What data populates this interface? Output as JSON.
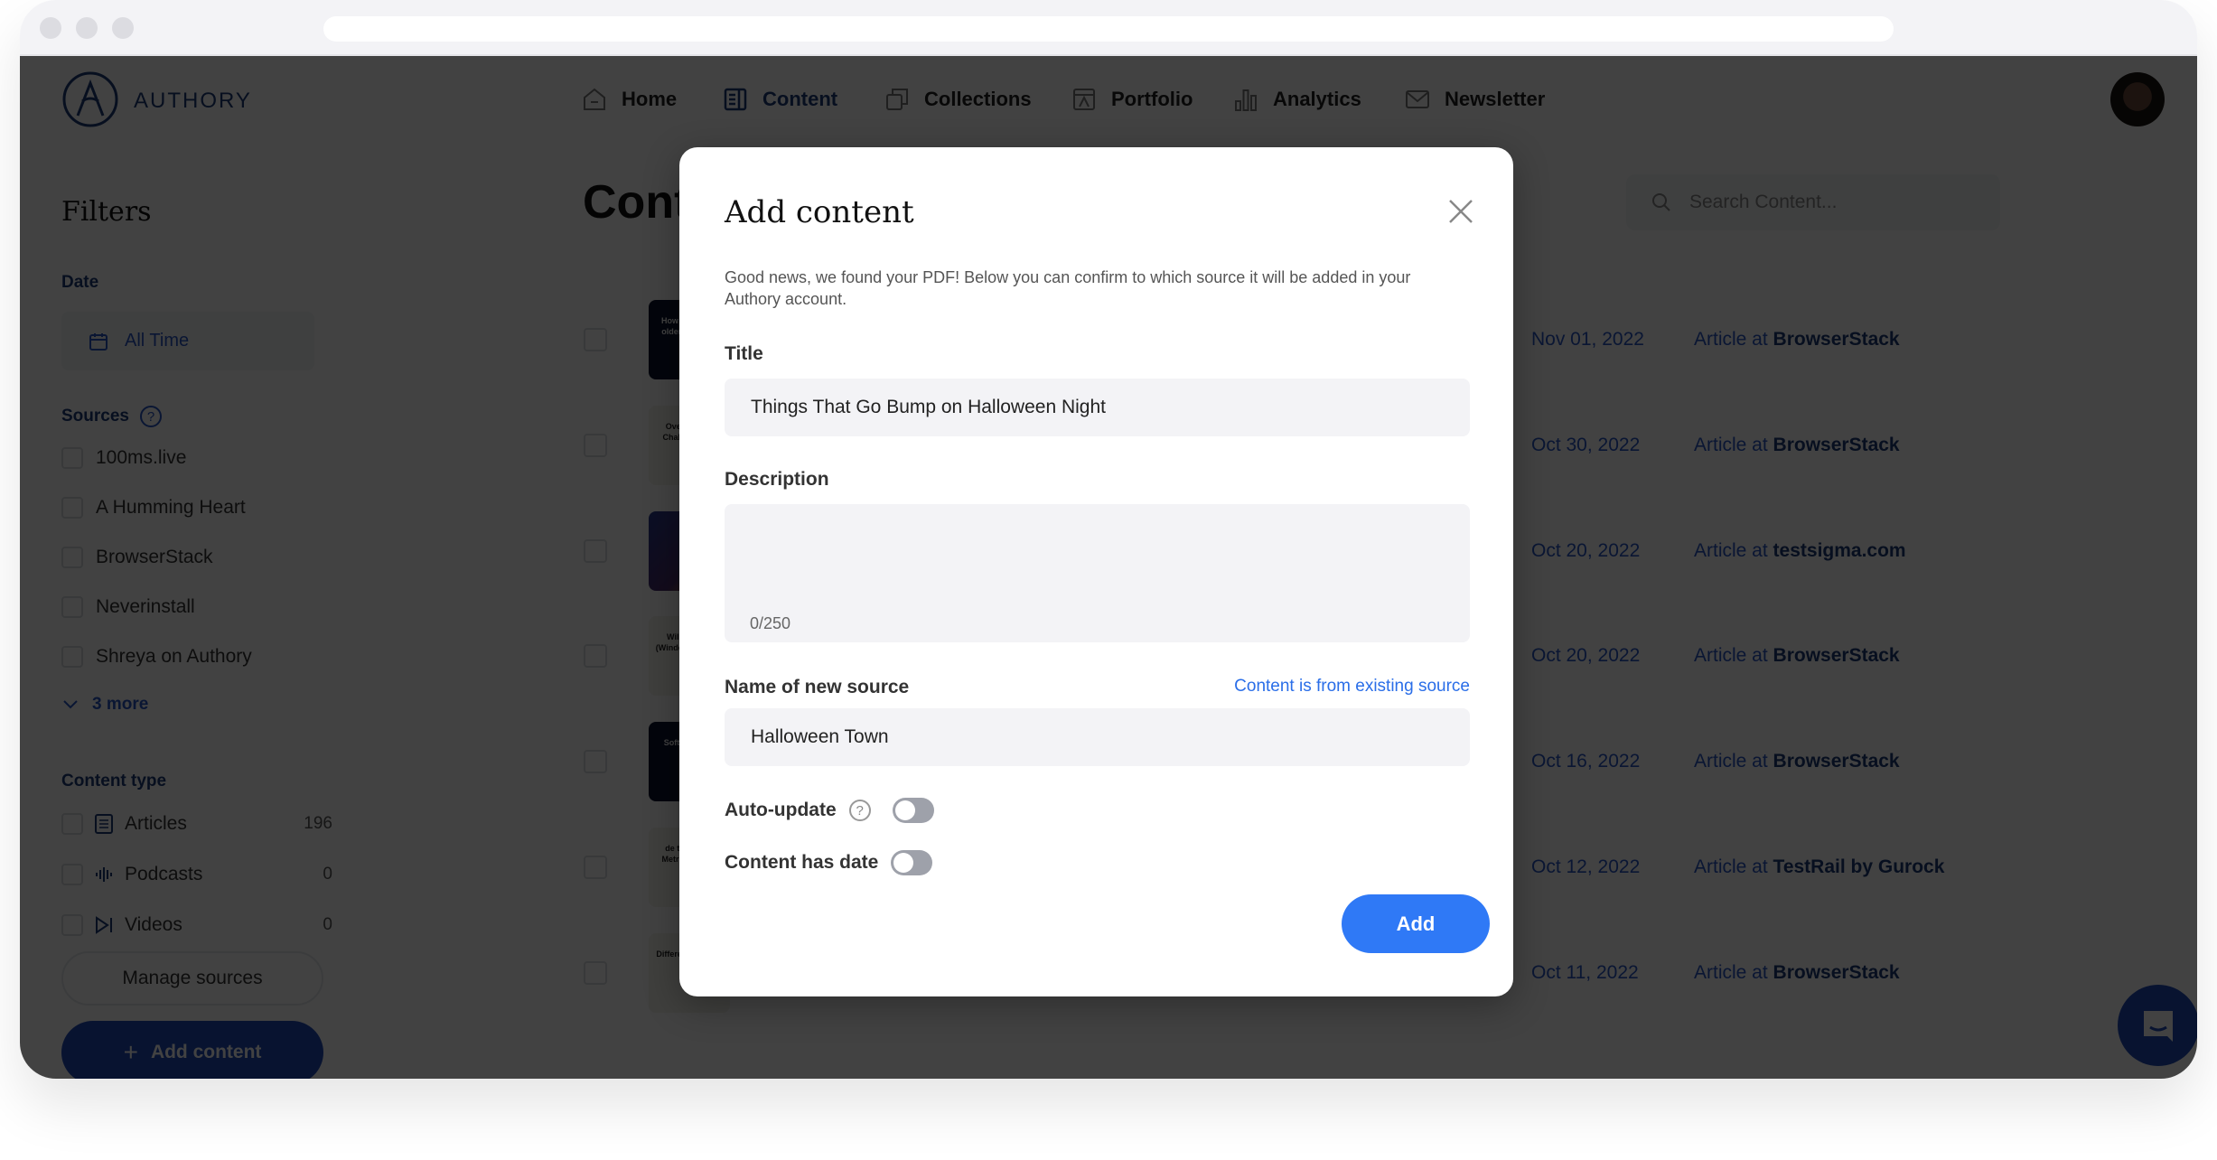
{
  "browser": {
    "traffic_lights": [
      "close",
      "minimize",
      "maximize"
    ],
    "url": ""
  },
  "header": {
    "brand": "AUTHORY",
    "nav": [
      {
        "label": "Home",
        "icon": "home-icon",
        "active": false
      },
      {
        "label": "Content",
        "icon": "content-icon",
        "active": true
      },
      {
        "label": "Collections",
        "icon": "collections-icon",
        "active": false
      },
      {
        "label": "Portfolio",
        "icon": "portfolio-icon",
        "active": false
      },
      {
        "label": "Analytics",
        "icon": "analytics-icon",
        "active": false
      },
      {
        "label": "Newsletter",
        "icon": "newsletter-icon",
        "active": false
      }
    ]
  },
  "sidebar": {
    "title": "Filters",
    "date_label": "Date",
    "date_value": "All Time",
    "sources_label": "Sources",
    "sources": [
      "100ms.live",
      "A Humming Heart",
      "BrowserStack",
      "Neverinstall",
      "Shreya on Authory"
    ],
    "more_label": "3 more",
    "content_type_label": "Content type",
    "content_types": [
      {
        "label": "Articles",
        "count": "196"
      },
      {
        "label": "Podcasts",
        "count": "0"
      },
      {
        "label": "Videos",
        "count": "0"
      }
    ],
    "manage_sources_label": "Manage sources",
    "add_content_label": "Add content"
  },
  "main": {
    "title": "Content",
    "search_placeholder": "Search Content...",
    "rows": [
      {
        "thumb_text": "How to test on older versions",
        "date": "Nov 01, 2022",
        "prefix": "Article at",
        "source": "BrowserStack"
      },
      {
        "thumb_text": "Overcoming Challenges of Test",
        "date": "Oct 30, 2022",
        "prefix": "Article at",
        "source": "BrowserStack"
      },
      {
        "thumb_text": "",
        "date": "Oct 20, 2022",
        "prefix": "Article at",
        "source": "testsigma.com"
      },
      {
        "thumb_text": "Will the iOS (Windows testing",
        "date": "Oct 20, 2022",
        "prefix": "Article at",
        "source": "BrowserStack"
      },
      {
        "thumb_text": "Software and",
        "date": "Oct 16, 2022",
        "prefix": "Article at",
        "source": "BrowserStack"
      },
      {
        "thumb_text": "de to the QA Metrics Matter",
        "date": "Oct 12, 2022",
        "prefix": "Article at",
        "source": "TestRail by Gurock"
      },
      {
        "thumb_text": "Differences Agile",
        "date": "Oct 11, 2022",
        "prefix": "Article at",
        "source": "BrowserStack"
      }
    ]
  },
  "modal": {
    "title": "Add content",
    "description": "Good news, we found your PDF! Below you can confirm to which source it will be added in your Authory account.",
    "title_label": "Title",
    "title_value": "Things That Go Bump on Halloween Night",
    "description_label": "Description",
    "description_value": "",
    "char_count": "0/250",
    "source_label": "Name of new source",
    "existing_source_link": "Content is from existing source",
    "source_value": "Halloween Town",
    "auto_update_label": "Auto-update",
    "auto_update_on": false,
    "content_has_date_label": "Content has date",
    "content_has_date_on": false,
    "add_button_label": "Add"
  },
  "colors": {
    "brand_navy": "#1d3b7a",
    "primary_blue": "#2f79f6",
    "link_blue": "#2a6ee8",
    "overlay": "#000000"
  }
}
